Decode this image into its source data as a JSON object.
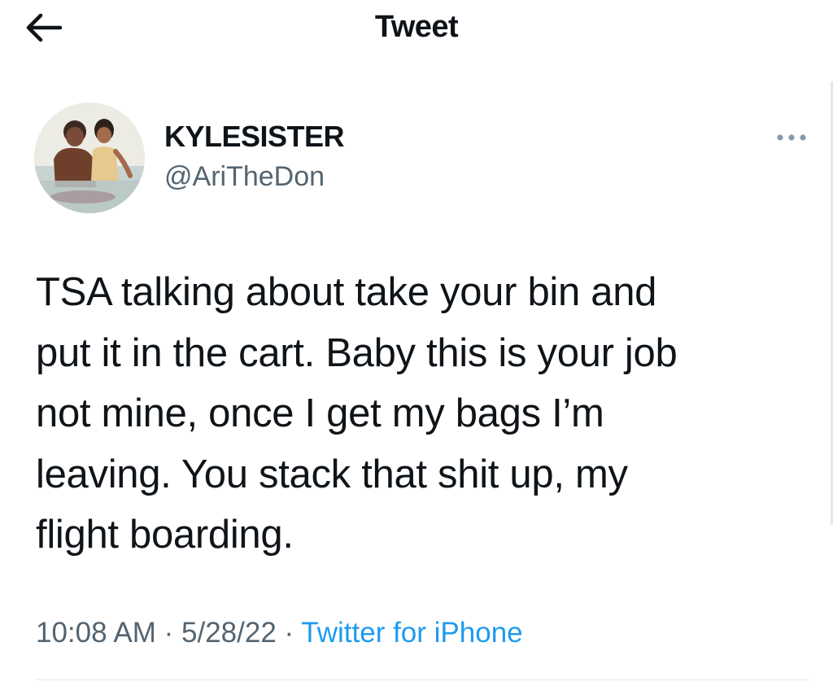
{
  "header": {
    "title": "Tweet",
    "back_icon": "arrow-left-icon"
  },
  "tweet": {
    "author": {
      "display_name": "KYLESISTER",
      "handle": "@AriTheDon",
      "avatar": "avatar-photo"
    },
    "more_icon": "more-horizontal-icon",
    "text_lines": [
      "TSA talking about take your bin and",
      "put it in the cart. Baby this is your job",
      "not mine, once I get my bags I’m",
      "leaving. You stack that shit up, my",
      "flight boarding."
    ],
    "time": "10:08 AM",
    "separator": "·",
    "date": "5/28/22",
    "source": "Twitter for iPhone"
  },
  "colors": {
    "text_primary": "#0f1419",
    "text_secondary": "#536471",
    "link": "#1d9bf0",
    "divider": "#e5e8ea"
  }
}
